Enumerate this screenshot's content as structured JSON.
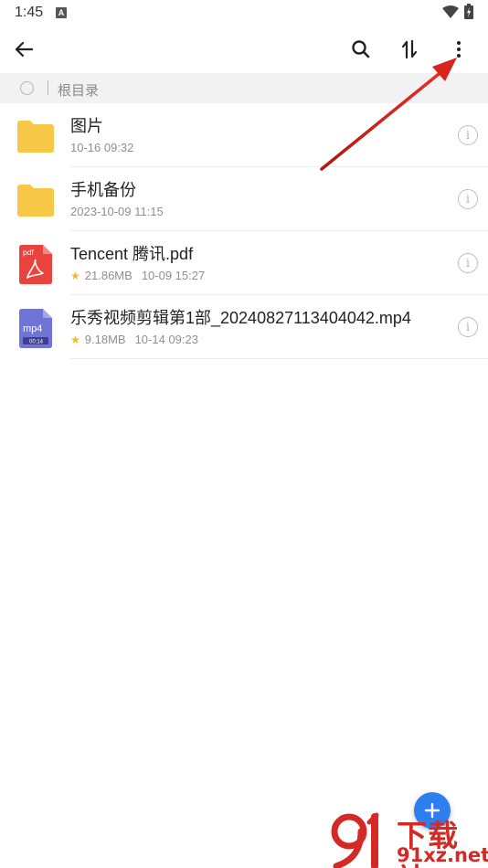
{
  "status_bar": {
    "time": "1:45",
    "notification_icon": "A"
  },
  "toolbar": {
    "back_icon": "arrow-left",
    "search_icon": "magnifier",
    "sort_icon": "sort-arrows",
    "more_icon": "vertical-dots"
  },
  "path_bar": {
    "label": "根目录"
  },
  "files": [
    {
      "name": "图片",
      "type": "folder",
      "size": "",
      "date": "10-16 09:32",
      "starred": false
    },
    {
      "name": "手机备份",
      "type": "folder",
      "size": "",
      "date": "2023-10-09 11:15",
      "starred": false
    },
    {
      "name": "Tencent 腾讯.pdf",
      "type": "pdf",
      "icon_label": "pdf",
      "size": "21.86MB",
      "date": "10-09 15:27",
      "starred": true
    },
    {
      "name": "乐秀视频剪辑第1部_20240827113404042.mp4",
      "type": "mp4",
      "icon_label": "mp4",
      "duration": "00:14",
      "size": "9.18MB",
      "date": "10-14 09:23",
      "starred": true
    }
  ],
  "fab": {
    "icon": "plus"
  },
  "watermark": {
    "title": "下载站",
    "url": "91xz.net"
  },
  "colors": {
    "accent": "#2f7ef0",
    "folder": "#f7c746",
    "pdf": "#e9433d",
    "video": "#6f74d6",
    "annotation_arrow": "#d9231d"
  }
}
